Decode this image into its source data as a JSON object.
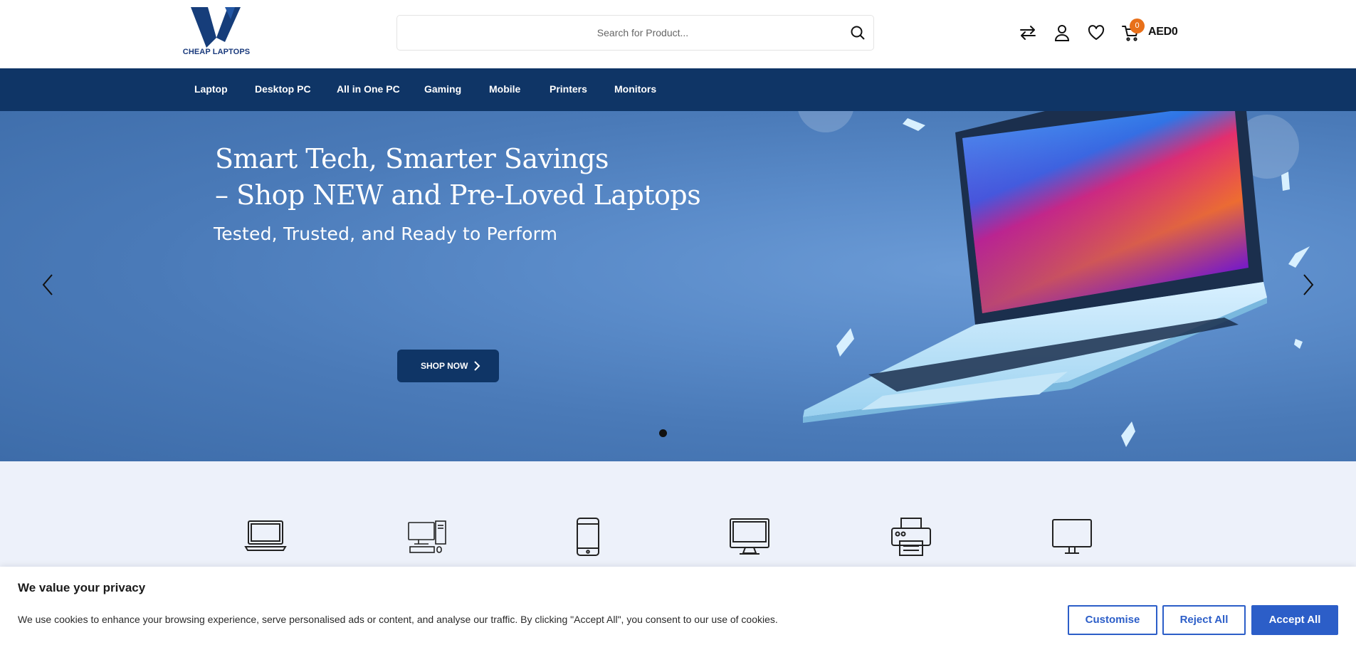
{
  "header": {
    "logo_text": "CHEAP LAPTOPS",
    "search_placeholder": "Search for Product...",
    "cart_count": "0",
    "cart_total": "AED0"
  },
  "nav": {
    "items": [
      "Laptop",
      "Desktop PC",
      "All in One PC",
      "Gaming",
      "Mobile",
      "Printers",
      "Monitors"
    ]
  },
  "hero": {
    "title_line1": "Smart Tech, Smarter Savings",
    "title_line2": "– Shop NEW and Pre-Loved Laptops",
    "subtitle": "Tested, Trusted, and Ready to Perform",
    "cta_label": "SHOP NOW"
  },
  "categories": [
    "laptop-icon",
    "desktop-pc-icon",
    "mobile-icon",
    "all-in-one-pc-icon",
    "printer-icon",
    "monitor-icon"
  ],
  "cookie": {
    "title": "We value your privacy",
    "text": "We use cookies to enhance your browsing experience, serve personalised ads or content, and analyse our traffic. By clicking \"Accept All\", you consent to our use of cookies.",
    "customise_label": "Customise",
    "reject_label": "Reject All",
    "accept_label": "Accept All"
  },
  "colors": {
    "brand_navy": "#0f3566",
    "hero_blue": "#4a7ab8",
    "badge_orange": "#e8701a",
    "cookie_blue": "#2c5ec8"
  }
}
